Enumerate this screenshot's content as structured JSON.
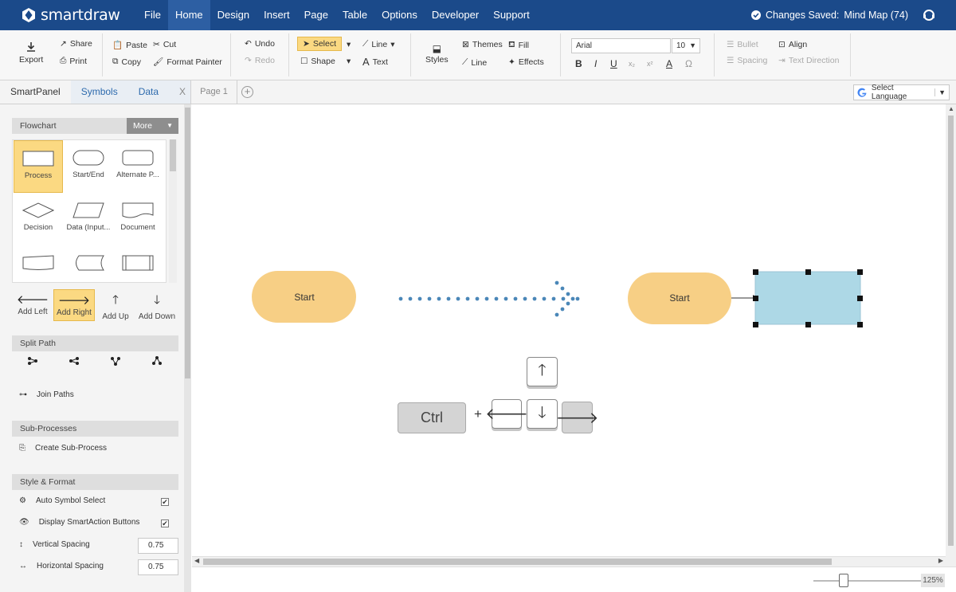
{
  "app": {
    "name": "smartdraw"
  },
  "menu": {
    "items": [
      "File",
      "Home",
      "Design",
      "Insert",
      "Page",
      "Table",
      "Options",
      "Developer",
      "Support"
    ],
    "active": "Home",
    "saved_label": "Changes Saved:",
    "doc_name": "Mind Map (74)"
  },
  "ribbon": {
    "export": "Export",
    "share": "Share",
    "print": "Print",
    "paste": "Paste",
    "cut": "Cut",
    "copy": "Copy",
    "format_painter": "Format Painter",
    "undo": "Undo",
    "redo": "Redo",
    "select": "Select",
    "line": "Line",
    "shape": "Shape",
    "text": "Text",
    "styles": "Styles",
    "themes": "Themes",
    "fill": "Fill",
    "line2": "Line",
    "effects": "Effects",
    "font": "Arial",
    "font_size": "10",
    "bullet": "Bullet",
    "spacing": "Spacing",
    "align": "Align",
    "text_direction": "Text Direction"
  },
  "panel": {
    "tabs": [
      "SmartPanel",
      "Symbols",
      "Data"
    ],
    "close": "X",
    "flowchart": "Flowchart",
    "more": "More",
    "shapes": [
      "Process",
      "Start/End",
      "Alternate P...",
      "Decision",
      "Data (Input...",
      "Document"
    ],
    "add": [
      "Add Left",
      "Add Right",
      "Add Up",
      "Add Down"
    ],
    "split_path": "Split Path",
    "join_paths": "Join Paths",
    "sub_processes": "Sub-Processes",
    "create_sub_process": "Create Sub-Process",
    "style_format": "Style & Format",
    "auto_symbol": "Auto Symbol Select",
    "display_smartaction": "Display SmartAction Buttons",
    "vertical_spacing": "Vertical Spacing",
    "vertical_value": "0.75",
    "horizontal_spacing": "Horizontal Spacing",
    "horizontal_value": "0.75"
  },
  "page": {
    "tab": "Page 1",
    "add": "+",
    "language": "Select Language"
  },
  "canvas": {
    "start_left": "Start",
    "start_right": "Start",
    "ctrl": "Ctrl",
    "plus": "+"
  },
  "zoom": {
    "value": "125%",
    "level": 125
  },
  "colors": {
    "brand": "#1b4a8a",
    "start_fill": "#f7cf85",
    "selected_fill": "#add8e6",
    "arrow_dots": "#4a87b8",
    "highlight": "#fbd982"
  }
}
